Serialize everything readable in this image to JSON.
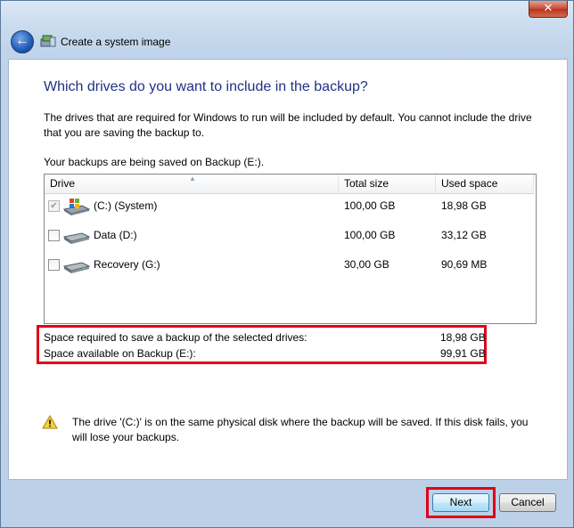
{
  "window": {
    "title": "Create a system image",
    "close_label": "✕",
    "back_label": "←"
  },
  "page": {
    "heading": "Which drives do you want to include in the backup?",
    "description": "The drives that are required for Windows to run will be included by default. You cannot include the drive that you are saving the backup to.",
    "saved_on": "Your backups are being saved on Backup (E:)."
  },
  "table": {
    "columns": [
      "Drive",
      "Total size",
      "Used space"
    ],
    "rows": [
      {
        "drive": "(C:) (System)",
        "total": "100,00 GB",
        "used": "18,98 GB",
        "checked": true,
        "disabled": true,
        "icon": "windows-drive-icon"
      },
      {
        "drive": "Data (D:)",
        "total": "100,00 GB",
        "used": "33,12 GB",
        "checked": false,
        "disabled": false,
        "icon": "hard-drive-icon"
      },
      {
        "drive": "Recovery (G:)",
        "total": "30,00 GB",
        "used": "90,69 MB",
        "checked": false,
        "disabled": false,
        "icon": "hard-drive-icon"
      }
    ]
  },
  "summary": {
    "required_label": "Space required to save a backup of the selected drives:",
    "required_value": "18,98 GB",
    "available_label": "Space available on Backup (E:):",
    "available_value": "99,91 GB"
  },
  "warning": {
    "icon": "warning-icon",
    "text": "The drive '(C:)' is on the same physical disk where the backup will be saved. If this disk fails, you will lose your backups."
  },
  "buttons": {
    "next": "Next",
    "cancel": "Cancel"
  },
  "colors": {
    "heading": "#1e3287",
    "highlight": "#e0001b"
  }
}
